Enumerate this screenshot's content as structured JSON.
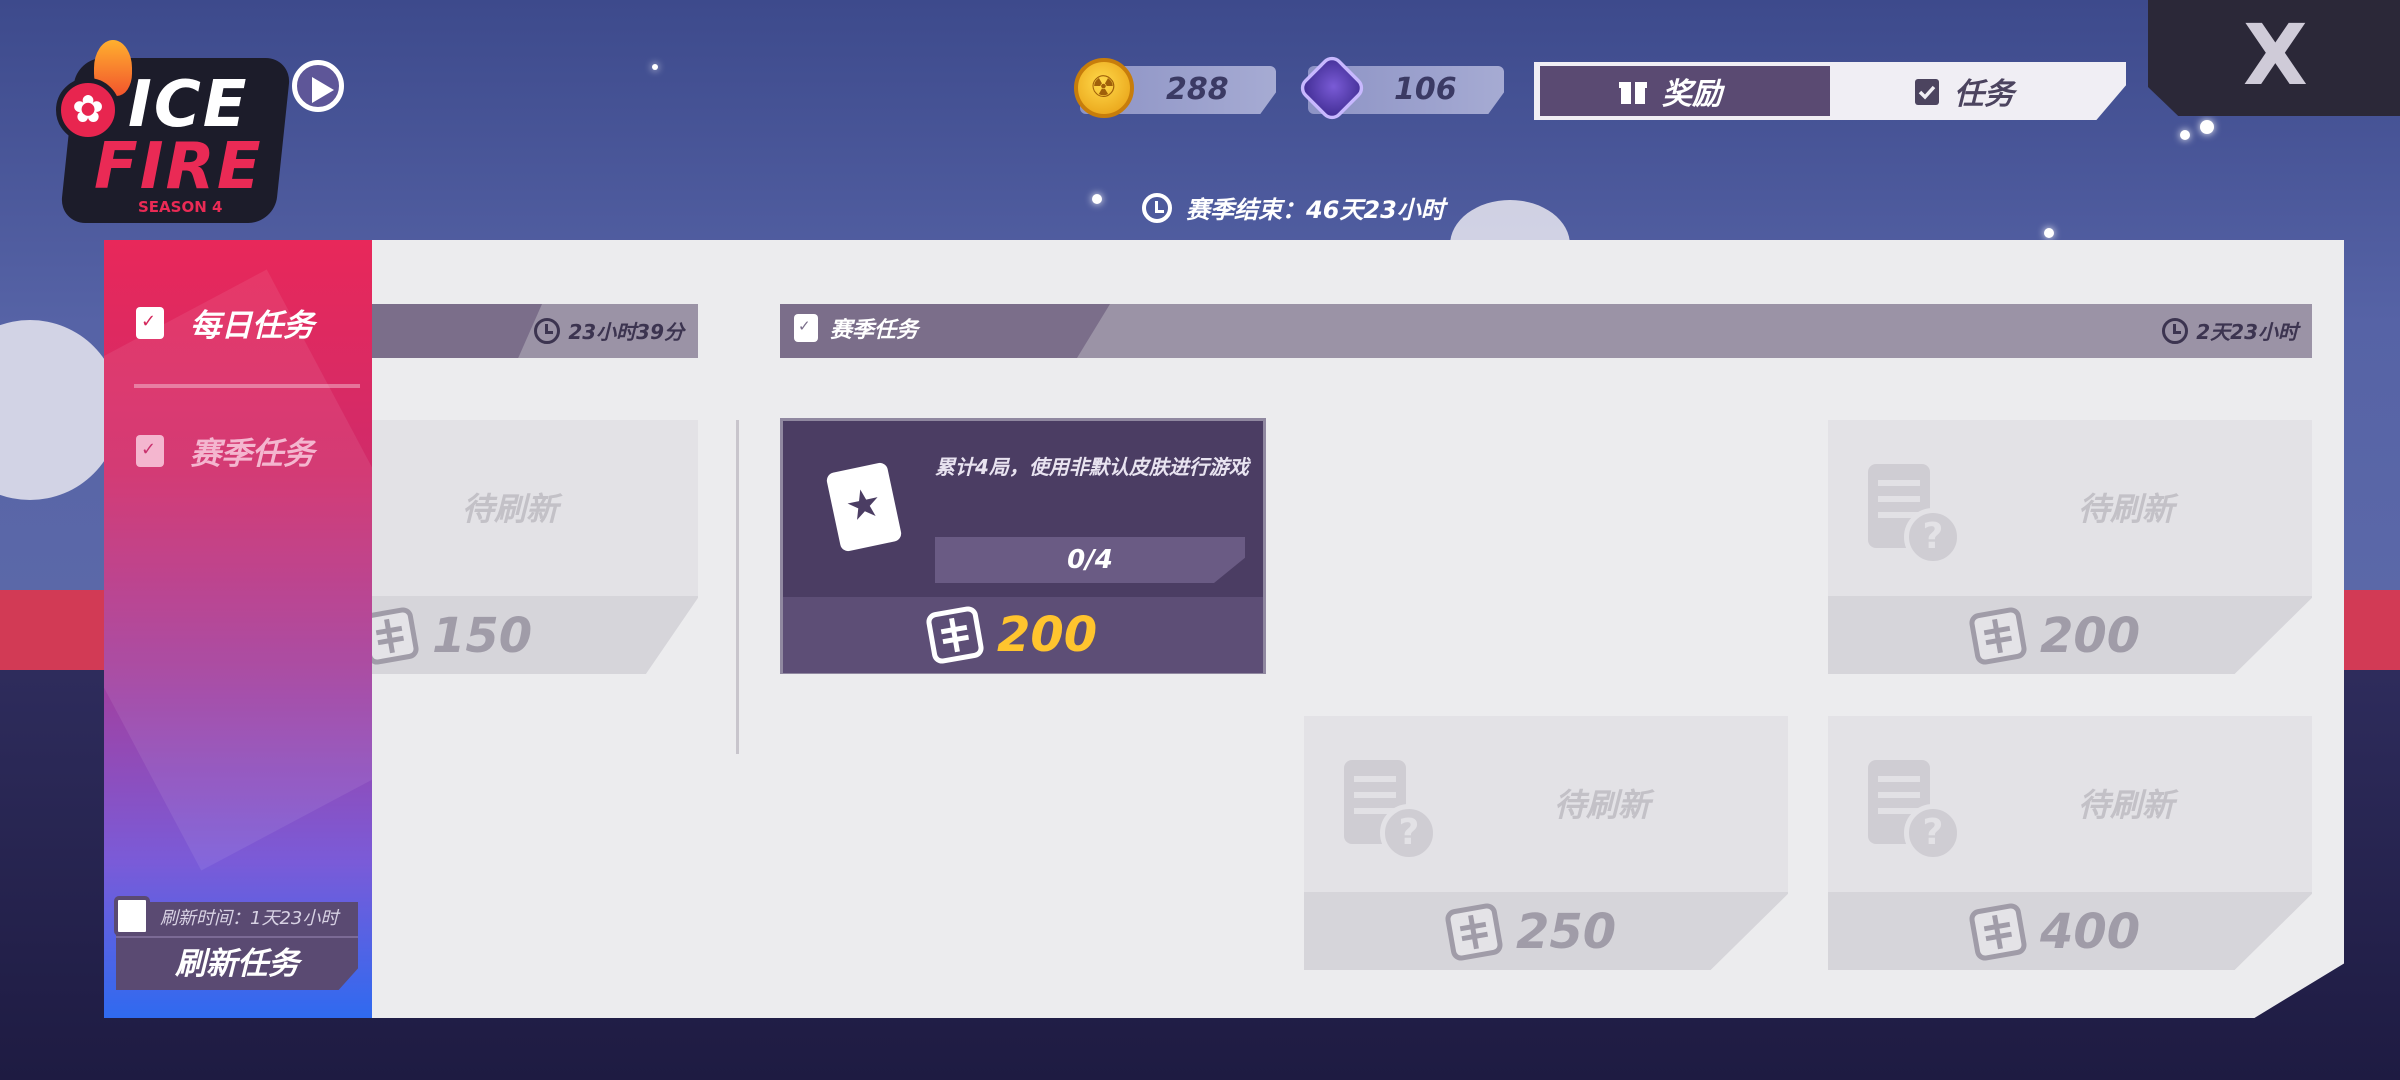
{
  "logo": {
    "line1": "ICE",
    "line2": "FIRE",
    "season": "SEASON 4"
  },
  "currencies": [
    {
      "icon": "gold-coin-icon",
      "value": "288"
    },
    {
      "icon": "purple-gem-icon",
      "value": "106"
    }
  ],
  "top_tabs": [
    {
      "icon": "gift-icon",
      "label": "奖励",
      "active": true
    },
    {
      "icon": "clipboard-icon",
      "label": "任务",
      "active": false
    }
  ],
  "close_label": "X",
  "season_end": "赛季结束：46天23小时",
  "sidebar": {
    "items": [
      {
        "label": "每日任务",
        "active": true
      },
      {
        "label": "赛季任务",
        "active": false
      }
    ],
    "refresh_time": "刷新时间：1天23小时",
    "refresh_button": "刷新任务"
  },
  "daily_section": {
    "timer": "23小时39分",
    "card": {
      "status": "待刷新",
      "reward": "150"
    }
  },
  "season_section": {
    "title": "赛季任务",
    "timer": "2天23小时",
    "active_card": {
      "description": "累计4局，使用非默认皮肤进行游戏",
      "progress": "0/4",
      "reward": "200"
    },
    "cards": [
      {
        "status": "待刷新",
        "reward": "200"
      },
      {
        "status": "待刷新",
        "reward": "250"
      },
      {
        "status": "待刷新",
        "reward": "400"
      }
    ]
  },
  "colors": {
    "accent_pink": "#e8285a",
    "panel_dark": "#5a4a72",
    "reward_gold": "#ffc42e"
  }
}
